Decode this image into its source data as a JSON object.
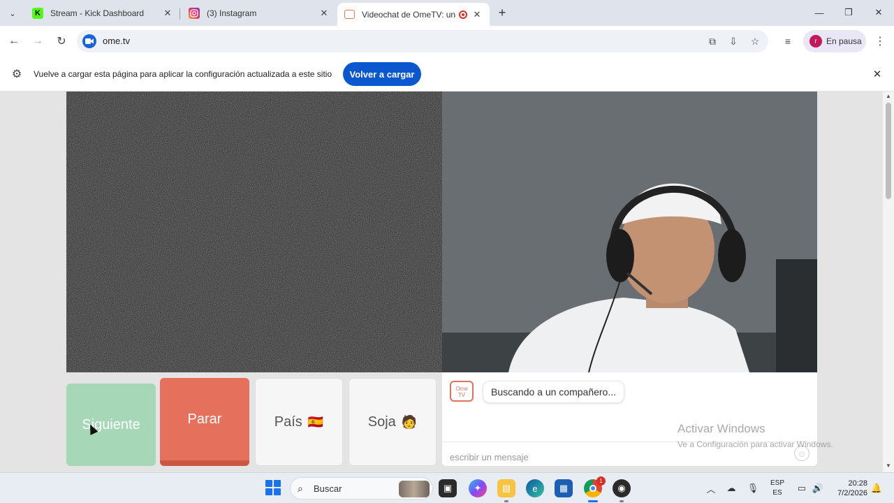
{
  "browser": {
    "tabs": [
      {
        "title": "Stream - Kick Dashboard",
        "icon": "kick-icon"
      },
      {
        "title": "(3) Instagram",
        "icon": "instagram-icon"
      },
      {
        "title": "Videochat de OmeTV: una a",
        "icon": "ometv-icon",
        "recording": true
      }
    ],
    "url": "ome.tv",
    "profile_label": "En pausa",
    "profile_initial": "r"
  },
  "infobar": {
    "message": "Vuelve a cargar esta página para aplicar la configuración actualizada a este sitio",
    "button_label": "Volver a cargar"
  },
  "controls": {
    "next_label": "Siguiente",
    "stop_label": "Parar",
    "country_label": "País",
    "country_emoji": "🇪🇸",
    "gender_label": "Soja",
    "gender_emoji": "🧑"
  },
  "chat": {
    "logo_text_1": "Ome",
    "logo_text_2": "TV",
    "status_message": "Buscando a un compañero...",
    "input_placeholder": "escribir un mensaje"
  },
  "watermark": {
    "title": "Activar Windows",
    "subtitle": "Ve a Configuración para activar Windows."
  },
  "taskbar": {
    "search_label": "Buscar",
    "lang_top": "ESP",
    "lang_bottom": "ES",
    "time": "20:28",
    "date": "7/2/2026",
    "chrome_badge": "1"
  },
  "colors": {
    "accent_blue": "#0b57d0",
    "next_green": "#a6d8b8",
    "stop_red": "#e5705b"
  }
}
